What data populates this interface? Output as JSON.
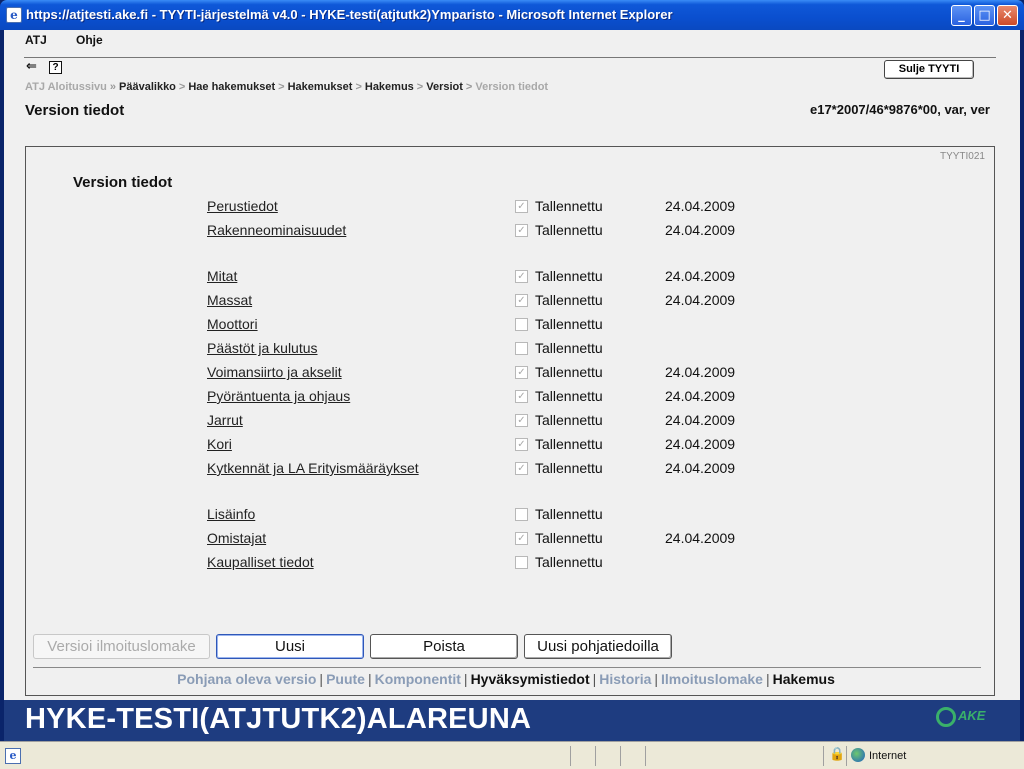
{
  "window": {
    "title": "https://atjtesti.ake.fi - TYYTI-järjestelmä v4.0 - HYKE-testi(atjtutk2)Ymparisto - Microsoft Internet Explorer",
    "minimize": "_",
    "maximize": "□",
    "close": "✕"
  },
  "menu": {
    "atj": "ATJ",
    "help": "Ohje"
  },
  "toolbar": {
    "close_label": "Sulje TYYTI",
    "help_glyph": "?"
  },
  "breadcrumb": [
    {
      "label": "ATJ Aloitussivu",
      "style": "dim"
    },
    {
      "label": "Päävalikko",
      "style": "link"
    },
    {
      "label": "Hae hakemukset",
      "style": "link"
    },
    {
      "label": "Hakemukset",
      "style": "link"
    },
    {
      "label": "Hakemus",
      "style": "link"
    },
    {
      "label": "Versiot",
      "style": "link"
    },
    {
      "label": "Version tiedot",
      "style": "dim"
    }
  ],
  "breadcrumb_separator": "»",
  "breadcrumb_separator_alt": ">",
  "page": {
    "title": "Version tiedot",
    "record_id": "e17*2007/46*9876*00, var, ver"
  },
  "panel": {
    "code": "TYYTI021",
    "section_title": "Version tiedot",
    "rows": [
      {
        "label": "Perustiedot",
        "checked": true,
        "status": "Tallennettu",
        "date": "24.04.2009"
      },
      {
        "label": "Rakenneominaisuudet",
        "checked": true,
        "status": "Tallennettu",
        "date": "24.04.2009"
      },
      {
        "label": "Mitat",
        "checked": true,
        "status": "Tallennettu",
        "date": "24.04.2009"
      },
      {
        "label": "Massat",
        "checked": true,
        "status": "Tallennettu",
        "date": "24.04.2009"
      },
      {
        "label": "Moottori",
        "checked": false,
        "status": "Tallennettu",
        "date": ""
      },
      {
        "label": "Päästöt ja kulutus",
        "checked": false,
        "status": "Tallennettu",
        "date": ""
      },
      {
        "label": "Voimansiirto ja akselit",
        "checked": true,
        "status": "Tallennettu",
        "date": "24.04.2009"
      },
      {
        "label": "Pyöräntuenta ja ohjaus",
        "checked": true,
        "status": "Tallennettu",
        "date": "24.04.2009"
      },
      {
        "label": "Jarrut",
        "checked": true,
        "status": "Tallennettu",
        "date": "24.04.2009"
      },
      {
        "label": "Kori",
        "checked": true,
        "status": "Tallennettu",
        "date": "24.04.2009"
      },
      {
        "label": "Kytkennät ja LA Erityismääräykset",
        "checked": true,
        "status": "Tallennettu",
        "date": "24.04.2009"
      },
      {
        "label": "Lisäinfo",
        "checked": false,
        "status": "Tallennettu",
        "date": ""
      },
      {
        "label": "Omistajat",
        "checked": true,
        "status": "Tallennettu",
        "date": "24.04.2009"
      },
      {
        "label": "Kaupalliset tiedot",
        "checked": false,
        "status": "Tallennettu",
        "date": ""
      }
    ],
    "buttons": {
      "version_form": "Versioi ilmoituslomake",
      "new": "Uusi",
      "delete": "Poista",
      "new_with_base": "Uusi pohjatiedoilla"
    },
    "bottom_nav": [
      {
        "label": "Pohjana oleva versio",
        "active": false
      },
      {
        "label": "Puute",
        "active": false
      },
      {
        "label": "Komponentit",
        "active": false
      },
      {
        "label": "Hyväksymistiedot",
        "active": true
      },
      {
        "label": "Historia",
        "active": false
      },
      {
        "label": "Ilmoituslomake",
        "active": false
      },
      {
        "label": "Hakemus",
        "active": true
      }
    ],
    "bottom_nav_separator": "|"
  },
  "footer": {
    "banner": "HYKE-TESTI(ATJTUTK2)ALAREUNA",
    "logo_text": "AKE"
  },
  "statusbar": {
    "zone": "Internet",
    "ie_glyph": "e"
  },
  "colors": {
    "link_dim": "#8a9cb6",
    "frame_blue": "#1e3c80",
    "checkbox_checked": "#a9a9a9"
  }
}
